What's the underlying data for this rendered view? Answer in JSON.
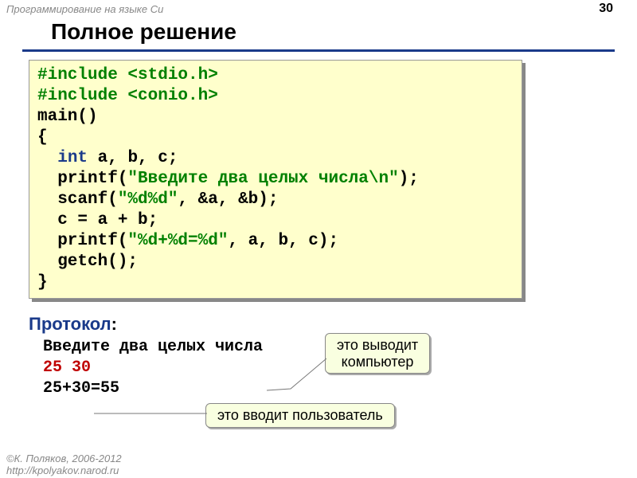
{
  "header": {
    "course": "Программирование на языке Си",
    "page": "30"
  },
  "title": "Полное решение",
  "code": {
    "l1a": "#include <stdio.h>",
    "l2a": "#include <conio.h>",
    "l3": "main()",
    "l4": "{",
    "l5a": "  ",
    "l5b": "int",
    "l5c": " a, b, c;",
    "l6a": "  printf(",
    "l6b": "\"Введите два целых числа\\n\"",
    "l6c": ");",
    "l7a": "  scanf(",
    "l7b": "\"%d%d\"",
    "l7c": ", &a, &b);",
    "l8": "  c = a + b;",
    "l9a": "  printf(",
    "l9b": "\"%d+%d=%d\"",
    "l9c": ", a, b, c);",
    "l10": "  getch();",
    "l11": "}"
  },
  "protocol": {
    "label": "Протокол",
    "colon": ":",
    "line1": "Введите два целых числа",
    "line2": "25 30",
    "line3": "25+30=55"
  },
  "callouts": {
    "computer": "это выводит\nкомпьютер",
    "user": "это вводит пользователь"
  },
  "footer": {
    "l1": "©К. Поляков, 2006-2012",
    "l2": "http://kpolyakov.narod.ru"
  }
}
